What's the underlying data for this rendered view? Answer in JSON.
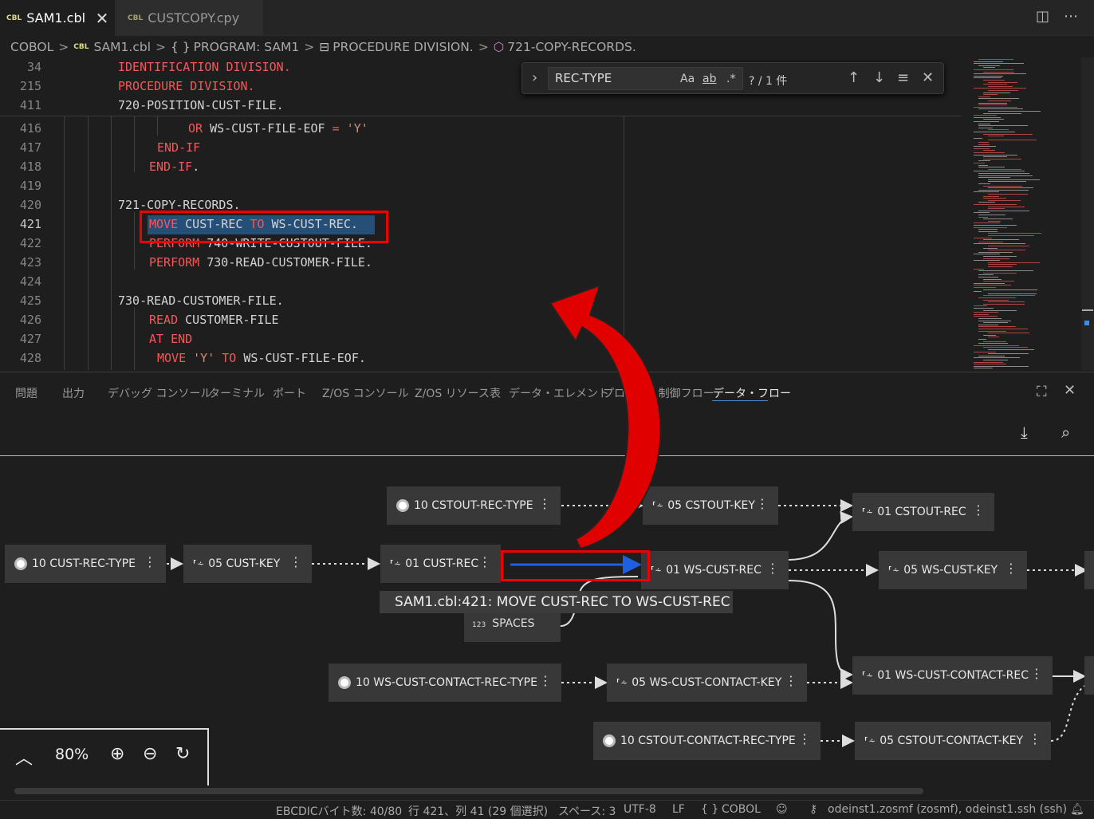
{
  "tabs": [
    {
      "badge": "CBL",
      "label": "SAM1.cbl",
      "active": true
    },
    {
      "badge": "CBL",
      "label": "CUSTCOPY.cpy",
      "active": false
    }
  ],
  "icons": {
    "close": "close-icon",
    "split": "split-editor-icon",
    "more": "more-icon"
  },
  "breadcrumb": {
    "items": [
      "COBOL",
      "SAM1.cbl",
      "PROGRAM: SAM1",
      "PROCEDURE DIVISION.",
      "721-COPY-RECORDS."
    ],
    "badge": "CBL",
    "braces": "{ }"
  },
  "sticky": [
    {
      "line": "34",
      "text": "IDENTIFICATION DIVISION."
    },
    {
      "line": "215",
      "text": "PROCEDURE DIVISION."
    },
    {
      "line": "411",
      "text": "720-POSITION-CUST-FILE."
    }
  ],
  "code": [
    {
      "line": "416",
      "t1": "OR",
      "t2": " WS-CUST-FILE-EOF ",
      "t3": "=",
      "t4": " 'Y'"
    },
    {
      "line": "417",
      "t1": "END-IF"
    },
    {
      "line": "418",
      "t1": "END-IF",
      "t2": "."
    },
    {
      "line": "419"
    },
    {
      "line": "420",
      "t2": "721-COPY-RECORDS."
    },
    {
      "line": "421",
      "t1": "MOVE",
      "t2": " CUST-REC ",
      "t3": "TO",
      "t4": " WS-CUST-REC."
    },
    {
      "line": "422",
      "t1": "PERFORM",
      "t2": " 740-WRITE-CUSTOUT-FILE."
    },
    {
      "line": "423",
      "t1": "PERFORM",
      "t2": " 730-READ-CUSTOMER-FILE."
    },
    {
      "line": "424"
    },
    {
      "line": "425",
      "t2": "730-READ-CUSTOMER-FILE."
    },
    {
      "line": "426",
      "t1": "READ",
      "t2": " CUSTOMER-FILE"
    },
    {
      "line": "427",
      "t1": "AT",
      "t2": " ",
      "t3": "END"
    },
    {
      "line": "428",
      "t1": "MOVE",
      "t2": " 'Y' ",
      "t3": "TO",
      "t4": " WS-CUST-FILE-EOF."
    }
  ],
  "find": {
    "query": "REC-TYPE",
    "match_case": "Aa",
    "whole_word": "ab",
    "regex": ".*",
    "count": "? / 1 件"
  },
  "panel_tabs": [
    "問題",
    "出力",
    "デバッグ コンソール",
    "ターミナル",
    "ポート",
    "Z/OS コンソール",
    "Z/OS リソース表",
    "データ・エレメント",
    "プログラム制御フロー",
    "データ・フロー"
  ],
  "active_panel": "データ・フロー",
  "nodes": {
    "cstout_rec_type": "10 CSTOUT-REC-TYPE",
    "cstout_key": "05 CSTOUT-KEY",
    "cstout_rec": "01 CSTOUT-REC",
    "cust_rec_type": "10 CUST-REC-TYPE",
    "cust_key": "05 CUST-KEY",
    "cust_rec": "01 CUST-REC",
    "ws_cust_rec": "01 WS-CUST-REC",
    "ws_cust_key": "05 WS-CUST-KEY",
    "ws_cust_contact_rec_type": "10 WS-CUST-CONTACT-REC-TYPE",
    "ws_cust_contact_key": "05 WS-CUST-CONTACT-KEY",
    "ws_cust_contact_rec": "01 WS-CUST-CONTACT-REC",
    "cstout_contact_rec_type": "10 CSTOUT-CONTACT-REC-TYPE",
    "cstout_contact_key": "05 CSTOUT-CONTACT-KEY"
  },
  "node_glyph": "⸢⸞",
  "tooltip": "SAM1.cbl:421: MOVE CUST-REC TO WS-CUST-REC",
  "spaces": {
    "badge": "123",
    "label": "SPACES"
  },
  "zoom": {
    "level": "80%"
  },
  "status": {
    "ebcdic": "EBCDICバイト数: 40/80",
    "position": "行 421、列 41 (29 個選択)",
    "indent": "スペース: 3",
    "encoding": "UTF-8",
    "eol": "LF",
    "braces": "{ }",
    "language": "COBOL",
    "remote": "odeinst1.zosmf (zosmf), odeinst1.ssh (ssh)"
  },
  "colors": {
    "accent": "#e00000",
    "flow": "#1e5fe0",
    "keyword": "#f05a5a"
  }
}
